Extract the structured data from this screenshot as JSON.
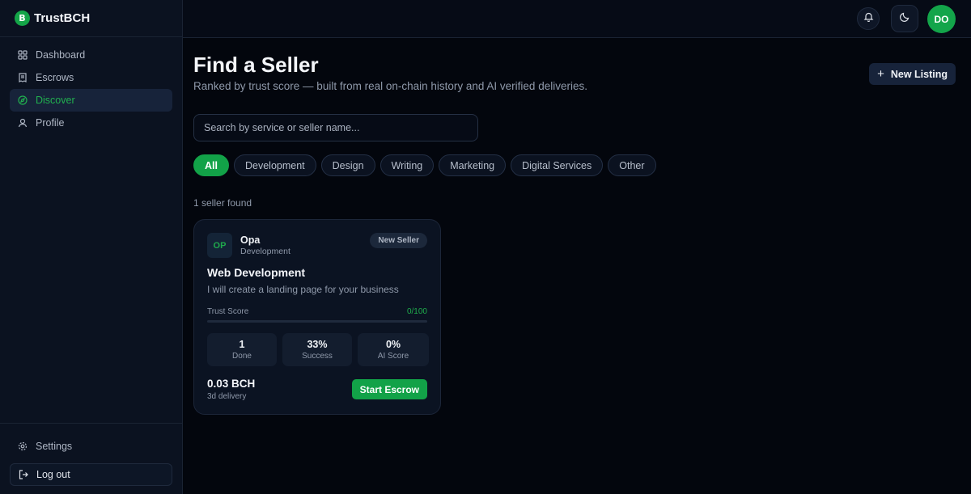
{
  "brand": {
    "name": "TrustBCH",
    "logo_glyph": "B"
  },
  "sidebar": {
    "items": [
      {
        "label": "Dashboard",
        "icon": "grid-icon",
        "active": false
      },
      {
        "label": "Escrows",
        "icon": "receipt-icon",
        "active": false
      },
      {
        "label": "Discover",
        "icon": "compass-icon",
        "active": true
      },
      {
        "label": "Profile",
        "icon": "user-icon",
        "active": false
      }
    ],
    "settings_label": "Settings",
    "logout_label": "Log out"
  },
  "topbar": {
    "user_initials": "DO",
    "notification_icon": "bell-icon",
    "theme_icon": "moon-icon"
  },
  "main": {
    "title": "Find a Seller",
    "subtitle": "Ranked by trust score — built from real on-chain history and AI verified deliveries.",
    "new_listing_label": "New Listing",
    "search_placeholder": "Search by service or seller name...",
    "filters": [
      {
        "label": "All",
        "active": true
      },
      {
        "label": "Development",
        "active": false
      },
      {
        "label": "Design",
        "active": false
      },
      {
        "label": "Writing",
        "active": false
      },
      {
        "label": "Marketing",
        "active": false
      },
      {
        "label": "Digital Services",
        "active": false
      },
      {
        "label": "Other",
        "active": false
      }
    ],
    "result_count": "1 seller found"
  },
  "seller_card": {
    "initials": "OP",
    "name": "Opa",
    "category": "Development",
    "badge": "New Seller",
    "service_title": "Web Development",
    "description": "I will create a landing page for your business",
    "trust_label": "Trust Score",
    "trust_value": "0/100",
    "trust_fraction": 0,
    "stats": [
      {
        "value": "1",
        "label": "Done"
      },
      {
        "value": "33%",
        "label": "Success"
      },
      {
        "value": "0%",
        "label": "AI Score"
      }
    ],
    "price": "0.03 BCH",
    "delivery": "3d delivery",
    "cta_label": "Start Escrow"
  },
  "colors": {
    "accent": "#12a248",
    "background": "#03060d",
    "sidebar": "#0b1220"
  }
}
